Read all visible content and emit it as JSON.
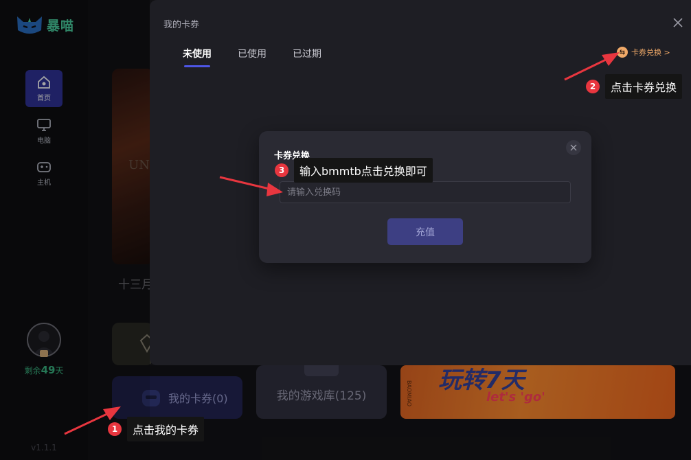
{
  "app": {
    "logo_text": "暴喵",
    "nav": [
      {
        "label": "首页",
        "icon": "home-icon"
      },
      {
        "label": "电脑",
        "icon": "monitor-icon"
      },
      {
        "label": "主机",
        "icon": "gamepad-icon"
      }
    ],
    "remain_prefix": "剩余",
    "remain_days": "49",
    "remain_suffix": "天",
    "version": "v1.1.1",
    "banner_text": "UN",
    "month_label": "十三月",
    "coupon_button": "我的卡券(0)",
    "library_button": "我的游戏库(125)",
    "promo_title": "玩转7天",
    "promo_sub": "let's 'go'",
    "promo_side": "BAOMIAO"
  },
  "modal": {
    "title": "我的卡券",
    "tabs": [
      {
        "label": "未使用",
        "active": true
      },
      {
        "label": "已使用",
        "active": false
      },
      {
        "label": "已过期",
        "active": false
      }
    ],
    "redeem_link": "卡券兑换 >"
  },
  "dialog": {
    "title": "卡券兑换",
    "input_placeholder": "请输入兑换码",
    "input_value": "",
    "submit": "充值"
  },
  "annotations": [
    {
      "number": "1",
      "text": "点击我的卡券"
    },
    {
      "number": "2",
      "text": "点击卡券兑换"
    },
    {
      "number": "3",
      "text": "输入bmmtb点击兑换即可"
    }
  ],
  "colors": {
    "accent": "#4e56e6",
    "brand_green": "#4ad1a1",
    "redeem_orange": "#f0a968",
    "annotation_red": "#e8363f"
  }
}
